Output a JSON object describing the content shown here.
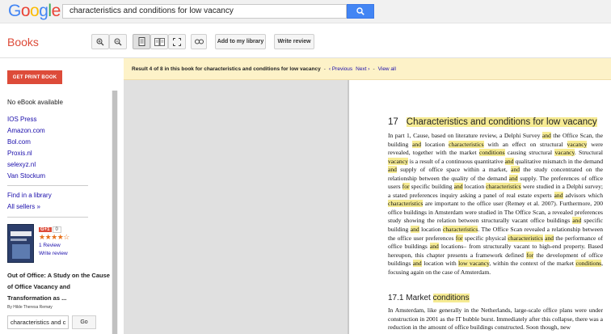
{
  "header": {
    "logo_letters": [
      {
        "ch": "G",
        "color": "#4285f4"
      },
      {
        "ch": "o",
        "color": "#ea4335"
      },
      {
        "ch": "o",
        "color": "#fbbc05"
      },
      {
        "ch": "g",
        "color": "#4285f4"
      },
      {
        "ch": "l",
        "color": "#34a853"
      },
      {
        "ch": "e",
        "color": "#ea4335"
      }
    ],
    "search_value": "characteristics and conditions for low vacancy"
  },
  "toolbar": {
    "section_label": "Books",
    "add_library_label": "Add to my library",
    "write_review_label": "Write review"
  },
  "banner": {
    "result_text": "Result 4 of 8 in this book for characteristics and conditions for low vacancy",
    "dash": "-",
    "previous_label": "‹ Previous",
    "next_label": "Next ›",
    "view_all_label": "View all"
  },
  "sidebar": {
    "print_button": "GET PRINT BOOK",
    "no_ebook": "No eBook available",
    "sellers": [
      "IOS Press",
      "Amazon.com",
      "Bol.com",
      "Proxis.nl",
      "selexyz.nl",
      "Van Stockum"
    ],
    "find_library": "Find in a library",
    "all_sellers": "All sellers »",
    "gplus_label": "G+1",
    "gplus_count": "0",
    "stars": "★★★★☆",
    "reviews": "1 Review",
    "write_review": "Write review",
    "book_title": "Out of Office: A Study on the Cause of Office Vacancy and Transformation as ...",
    "book_author": "By Hilde Theresa Remøy",
    "search_in_book_value": "characteristics and c",
    "go_label": "Go"
  },
  "page": {
    "chapter_number": "17",
    "chapter_title": "Characteristics and conditions for low vacancy",
    "section_title_a": "17.1 Market ",
    "section_title_b": "conditions"
  },
  "colors": {
    "brand_red": "#dd4b39",
    "highlight": "#f6eb93",
    "link": "#1a0dab",
    "search_blue": "#4285f4"
  }
}
